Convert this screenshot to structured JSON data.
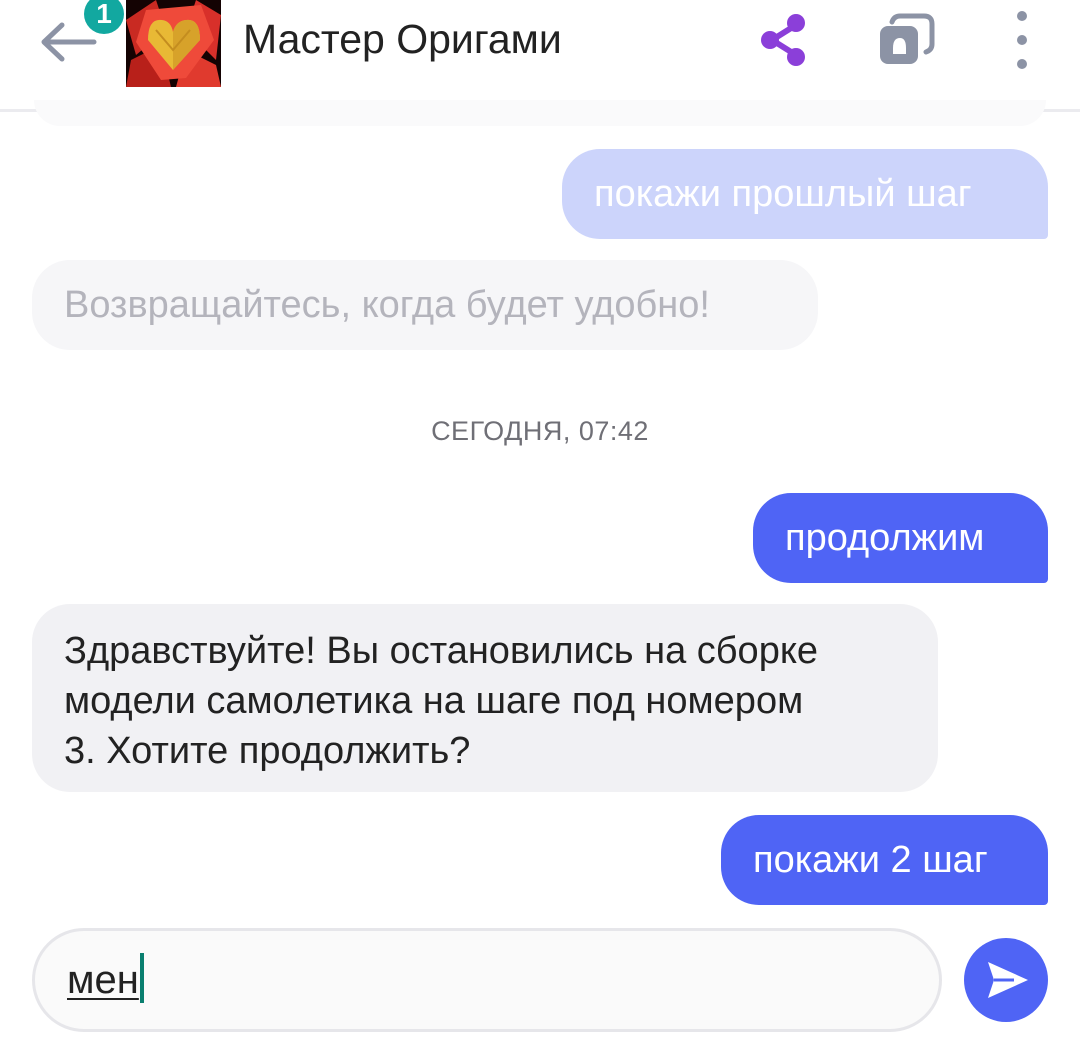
{
  "header": {
    "title": "Мастер Оригами",
    "badge_count": "1",
    "icons": [
      "back-arrow-icon",
      "share-icon",
      "cards-icon",
      "more-vertical-icon"
    ],
    "share_color": "#8b3fd9",
    "icon_color": "#8c93a5"
  },
  "messages": [
    {
      "from": "user",
      "text": "покажи прошлый шаг",
      "faded": true
    },
    {
      "from": "bot",
      "text": "Возвращайтесь, когда будет удобно!",
      "faded": true
    },
    {
      "from": "user",
      "text": "продолжим"
    },
    {
      "from": "bot",
      "lines": [
        "Здравствуйте! Вы остановились на сборке",
        "модели самолетика на шаге под номером",
        "3. Хотите продолжить?"
      ]
    },
    {
      "from": "user",
      "text": "покажи 2 шаг"
    }
  ],
  "date_divider": "СЕГОДНЯ, 07:42",
  "composer": {
    "value": "мен",
    "send_icon": "send-icon"
  },
  "colors": {
    "accent": "#4f64f5",
    "accent_faded": "#ccd4fb",
    "bot_bubble": "#f1f1f4",
    "badge": "#12a8a0"
  }
}
